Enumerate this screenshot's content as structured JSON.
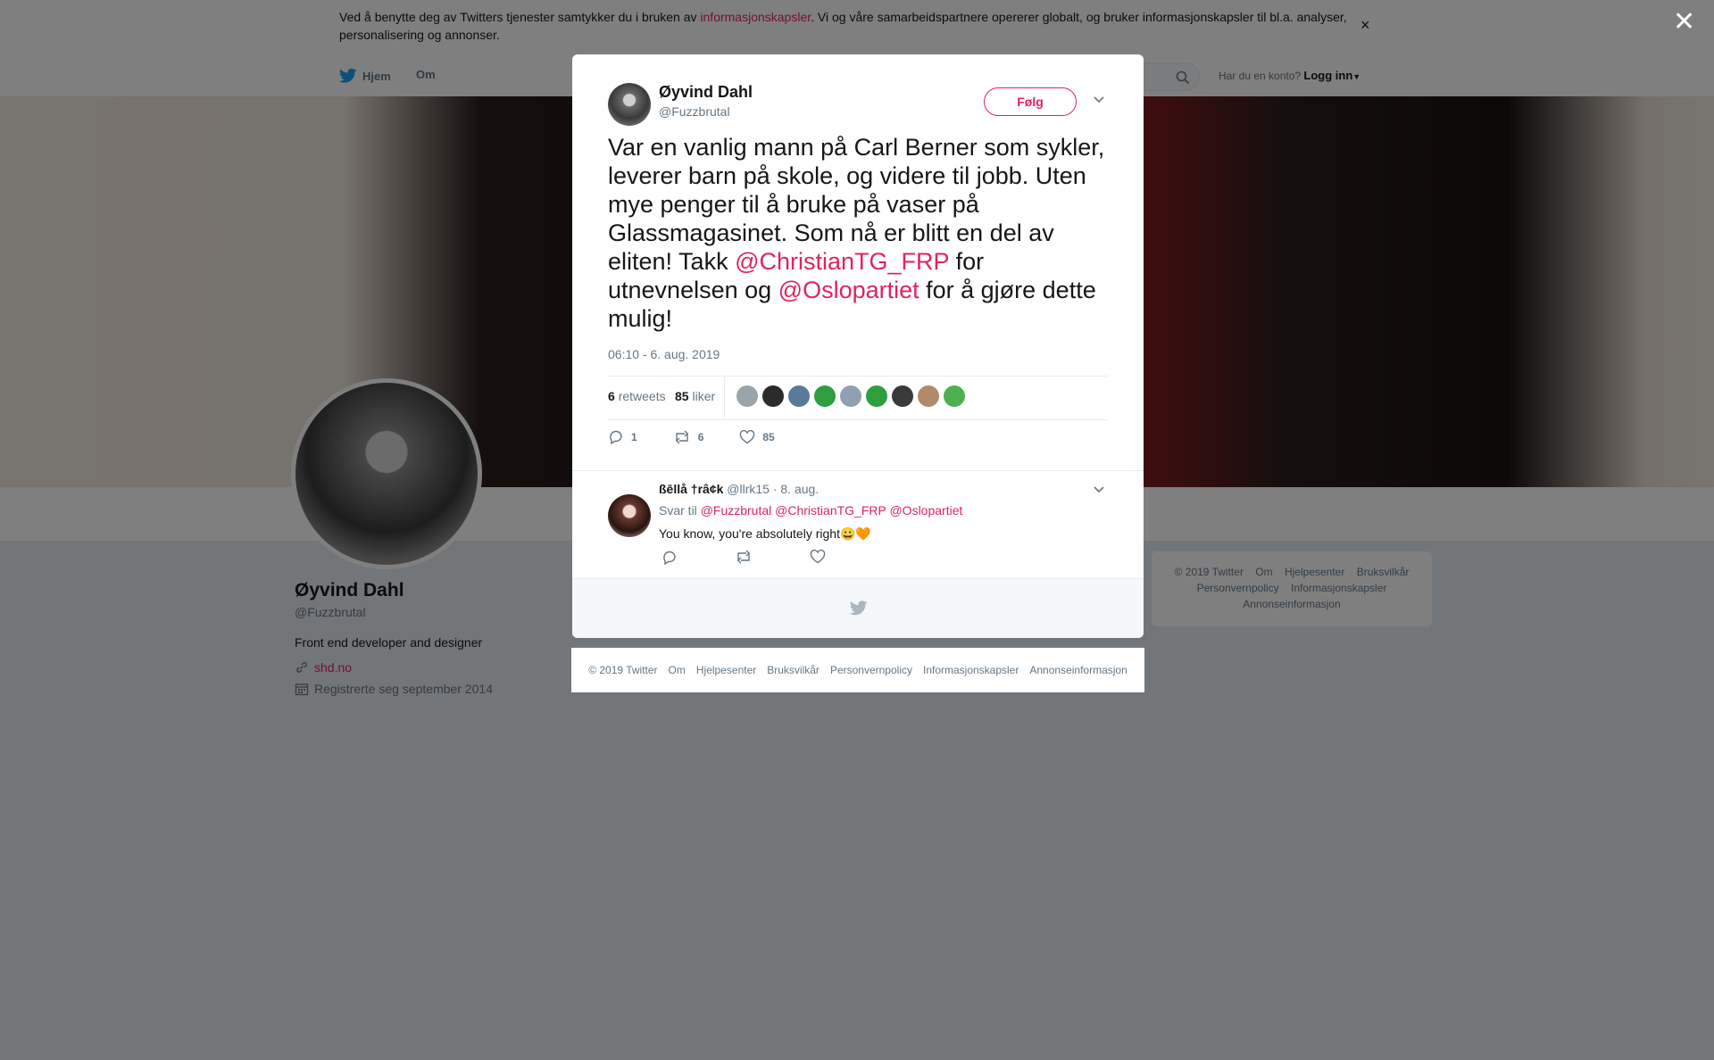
{
  "cookie": {
    "text_before": "Ved å benytte deg av Twitters tjenester samtykker du i bruken av ",
    "link": "informasjonskapsler",
    "text_after": ". Vi og våre samarbeidspartnere opererer globalt, og bruker informasjonskapsler til bl.a. analyser, personalisering og annonser.",
    "close": "×"
  },
  "nav": {
    "home": "Hjem",
    "about": "Om",
    "login_prompt": "Har du en konto?",
    "login": "Logg inn"
  },
  "profile": {
    "name": "Øyvind Dahl",
    "handle": "@Fuzzbrutal",
    "bio": "Front end developer and designer",
    "url": "shd.no",
    "joined": "Registrerte seg september 2014"
  },
  "side_footer": {
    "items": [
      "© 2019 Twitter",
      "Om",
      "Hjelpesenter",
      "Bruksvilkår",
      "Personvernpolicy",
      "Informasjonskapsler",
      "Annonseinformasjon"
    ]
  },
  "overlay_close": "✕",
  "tweet": {
    "author_name": "Øyvind Dahl",
    "author_handle": "@Fuzzbrutal",
    "follow_label": "Følg",
    "text_1": "Var en vanlig mann på Carl Berner som sykler, leverer barn på skole, og videre til jobb. Uten mye penger til å bruke på vaser på Glassmagasinet. Som nå er blitt en del av eliten! Takk ",
    "mention_1": "@ChristianTG_FRP",
    "text_2": " for utnevnelsen og ",
    "mention_2": "@Oslopartiet",
    "text_3": " for å gjøre dette mulig!",
    "timestamp": "06:10 - 6. aug. 2019",
    "retweets_count": "6",
    "retweets_label": "retweets",
    "likes_count": "85",
    "likes_label": "liker",
    "liker_avatar_colors": [
      "#9aa4ab",
      "#2b2b2b",
      "#5a7a99",
      "#2e9e3e",
      "#8fa0b0",
      "#2e9e3e",
      "#3a3a3a",
      "#b08a6a",
      "#4caf50"
    ],
    "reply_count": "1",
    "retweet_count": "6",
    "like_count": "85"
  },
  "reply": {
    "name": "ßēllå †râ¢k",
    "handle": "@llrk15",
    "date": "· 8. aug.",
    "to_label": "Svar til",
    "to_mentions": "@Fuzzbrutal @ChristianTG_FRP @Oslopartiet",
    "body": "You know, you're absolutely right😀🧡"
  },
  "modal_footer": {
    "items": [
      "© 2019 Twitter",
      "Om",
      "Hjelpesenter",
      "Bruksvilkår",
      "Personvernpolicy",
      "Informasjonskapsler",
      "Annonseinformasjon"
    ]
  }
}
